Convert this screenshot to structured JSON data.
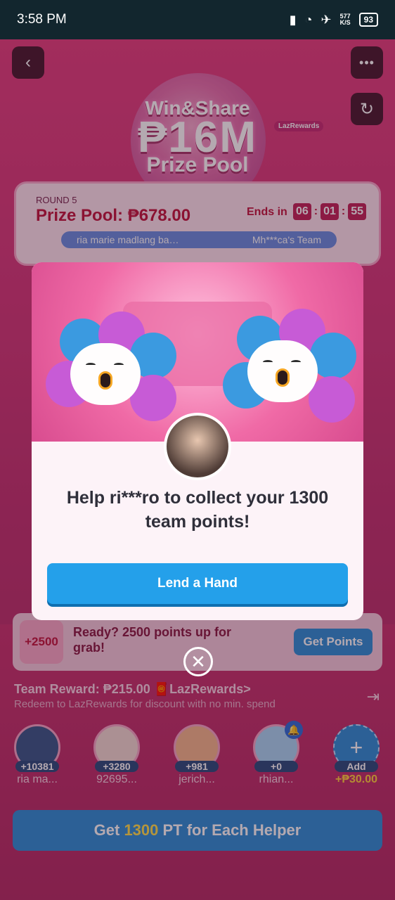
{
  "status_bar": {
    "time": "3:58 PM",
    "speed": "577\nK/S",
    "battery": "93"
  },
  "background": {
    "banner": {
      "line1": "Win&Share",
      "line2": "₱16M",
      "line3": "Prize Pool",
      "badge": "LazRewards"
    },
    "round": {
      "label": "ROUND 5",
      "prize_pool": "Prize Pool: ₱678.00",
      "ends_label": "Ends in",
      "timer": [
        "06",
        "01",
        "55"
      ],
      "team_left": "ria marie madlang ba…",
      "team_right": "Mh***ca's Team"
    },
    "offer": {
      "badge": "+2500",
      "text": "Ready? 2500 points up for grab!",
      "button": "Get Points"
    },
    "team_reward": {
      "title": "Team Reward: ₱215.00 🧧LazRewards>",
      "subtitle": "Redeem to LazRewards for discount with no min. spend"
    },
    "helpers": [
      {
        "points": "+10381",
        "name": "ria ma..."
      },
      {
        "points": "+3280",
        "name": "92695..."
      },
      {
        "points": "+981",
        "name": "jerich..."
      },
      {
        "points": "+0",
        "name": "rhian..."
      },
      {
        "points": "Add",
        "name": "+₱30.00"
      }
    ],
    "cta": {
      "prefix": "Get ",
      "highlight": "1300",
      "suffix": " PT for Each Helper"
    }
  },
  "modal": {
    "message": "Help ri***ro to collect your 1300 team points!",
    "button": "Lend a Hand",
    "close_symbol": "✕"
  },
  "colors": {
    "accent_blue": "#24a0ea",
    "pink_bg": "#d43a7a",
    "highlight_yellow": "#ffe14d"
  },
  "icons": [
    "back-icon",
    "more-icon",
    "refresh-icon",
    "close-icon",
    "add-icon",
    "bell-icon",
    "exit-icon"
  ]
}
